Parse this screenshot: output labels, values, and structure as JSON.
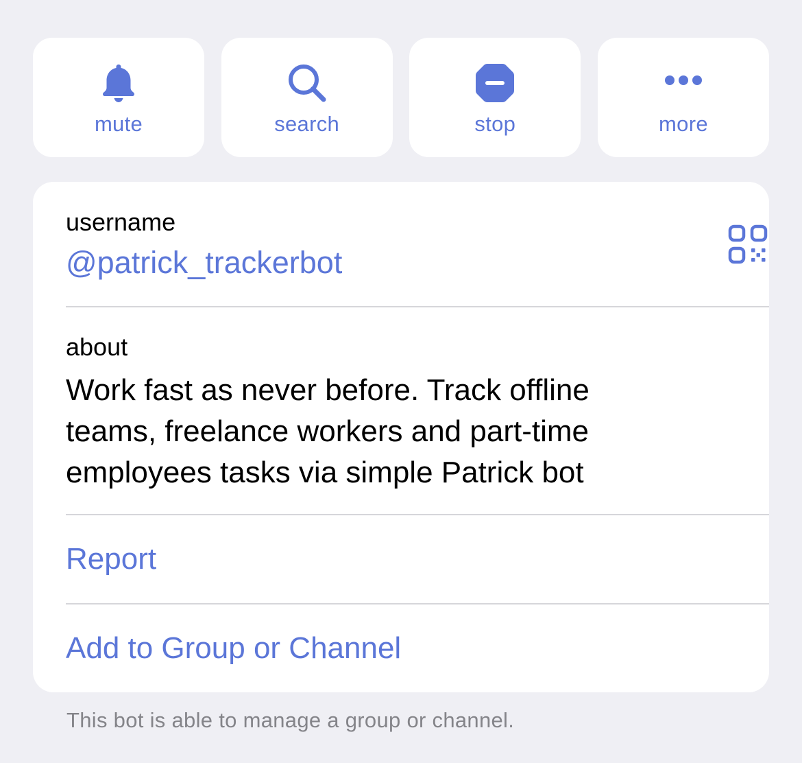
{
  "accent_color": "#5b76d8",
  "actions": [
    {
      "label": "mute",
      "icon": "bell-icon"
    },
    {
      "label": "search",
      "icon": "magnifier-icon"
    },
    {
      "label": "stop",
      "icon": "stop-icon"
    },
    {
      "label": "more",
      "icon": "ellipsis-icon"
    }
  ],
  "info": {
    "username_label": "username",
    "username_value": "@patrick_trackerbot",
    "qr_icon": "qr-code-icon",
    "about_label": "about",
    "about_lines": [
      "Work fast as never before. Track offline",
      "teams, freelance workers and part-time",
      "employees tasks via simple Patrick bot"
    ],
    "report_label": "Report",
    "add_label": "Add to Group or Channel"
  },
  "footer_note": "This bot is able to manage a group or channel."
}
